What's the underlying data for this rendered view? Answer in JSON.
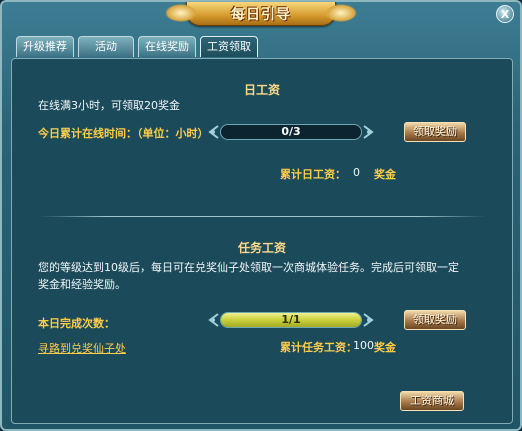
{
  "window": {
    "title": "每日引导",
    "close_label": "X"
  },
  "tabs": [
    {
      "label": "升级推荐",
      "active": false
    },
    {
      "label": "活动",
      "active": false
    },
    {
      "label": "在线奖励",
      "active": false
    },
    {
      "label": "工资领取",
      "active": true
    }
  ],
  "daily_wage": {
    "title": "日工资",
    "description": "在线满3小时，可领取20奖金",
    "progress_label": "今日累计在线时间：（单位：小时）",
    "progress_text": "0/3",
    "progress_fraction": 0,
    "claim_button": "领取奖励",
    "total_label": "累计日工资：",
    "total_value": "0",
    "total_unit": "奖金"
  },
  "task_wage": {
    "title": "任务工资",
    "description_line1": "您的等级达到10级后，每日可在兑奖仙子处领取一次商城体验任务。完成后可领取一定",
    "description_line2": "奖金和经验奖励。",
    "progress_label": "本日完成次数：",
    "progress_text": "1/1",
    "progress_fraction": 1,
    "claim_button": "领取奖励",
    "link_text": "寻路到兑奖仙子处",
    "total_label": "累计任务工资：",
    "total_value": "100",
    "total_unit": "奖金"
  },
  "footer": {
    "shop_button": "工资商城"
  },
  "colors": {
    "gold_text": "#ffcd4a",
    "section_title": "#ffd98a",
    "bar_fill": "#c9cf3c"
  }
}
